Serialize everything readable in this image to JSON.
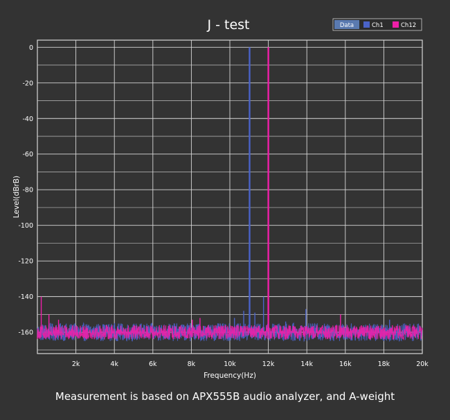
{
  "caption": "Measurement is based on APX555B audio analyzer, and A-weight",
  "colors": {
    "background": "#333333",
    "grid": "#d8d8d8",
    "ch1": "#4a63c8",
    "ch12": "#ee1fa8",
    "data_chip": "#5a7ab0"
  },
  "chart_data": {
    "type": "line",
    "title": "J - test",
    "xlabel": "Frequency(Hz)",
    "ylabel": "Level(dBrB)",
    "xlim": [
      0,
      20000
    ],
    "ylim": [
      -172,
      4
    ],
    "xticks": [
      2000,
      4000,
      6000,
      8000,
      10000,
      12000,
      14000,
      16000,
      18000,
      20000
    ],
    "xtick_labels": [
      "2k",
      "4k",
      "6k",
      "8k",
      "10k",
      "12k",
      "14k",
      "16k",
      "18k",
      "20k"
    ],
    "yticks": [
      0,
      -20,
      -40,
      -60,
      -80,
      -100,
      -120,
      -140,
      -160
    ],
    "ytick_labels": [
      "0",
      "-20",
      "-40",
      "-60",
      "-80",
      "-100",
      "-120",
      "-140",
      "-160"
    ],
    "grid": true,
    "legend": {
      "placement": "top-right",
      "header": "Data",
      "entries": [
        "Ch1",
        "Ch12"
      ]
    },
    "series": [
      {
        "name": "Ch1",
        "color": "#4a63c8",
        "noise_floor": -160,
        "noise_spread": 5,
        "peaks": [
          {
            "x": 11025,
            "y": 0
          },
          {
            "x": 10240,
            "y": -152
          },
          {
            "x": 10720,
            "y": -148
          },
          {
            "x": 11300,
            "y": -149
          },
          {
            "x": 11750,
            "y": -140
          },
          {
            "x": 12900,
            "y": -154
          },
          {
            "x": 13950,
            "y": -147
          },
          {
            "x": 18300,
            "y": -153
          },
          {
            "x": 7950,
            "y": -155
          },
          {
            "x": 1300,
            "y": -156
          }
        ]
      },
      {
        "name": "Ch12",
        "color": "#ee1fa8",
        "noise_floor": -160,
        "noise_spread": 4,
        "peaks": [
          {
            "x": 12000,
            "y": 0
          },
          {
            "x": 200,
            "y": -140
          },
          {
            "x": 600,
            "y": -150
          },
          {
            "x": 1100,
            "y": -153
          },
          {
            "x": 8050,
            "y": -153
          },
          {
            "x": 8450,
            "y": -152
          },
          {
            "x": 15750,
            "y": -150
          }
        ]
      }
    ]
  }
}
